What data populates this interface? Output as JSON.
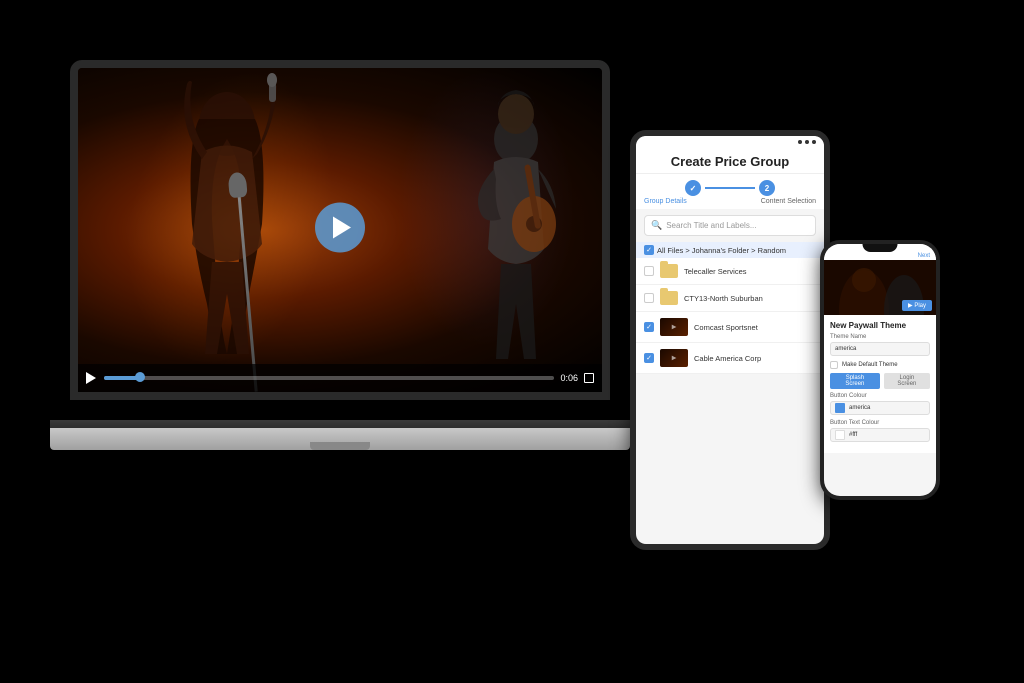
{
  "background": "#000000",
  "laptop": {
    "video": {
      "play_button_visible": true,
      "time_display": "0:06",
      "progress_percent": 8
    }
  },
  "tablet": {
    "status_dots": 3,
    "title": "Create Price Group",
    "steps": [
      {
        "label": "Group Details",
        "active": true,
        "number": "1"
      },
      {
        "label": "Content Selection",
        "active": false,
        "number": "2"
      }
    ],
    "search_placeholder": "Search Title and Labels...",
    "breadcrumb": "All Files > Johanna's Folder > Random",
    "files": [
      {
        "name": "Telecaller Services",
        "type": "folder",
        "checked": false
      },
      {
        "name": "CTY13-North Suburban",
        "type": "folder",
        "checked": false
      },
      {
        "name": "Comcast Sportsnet",
        "type": "video",
        "checked": true
      },
      {
        "name": "Cable America Corp",
        "type": "video",
        "checked": true
      }
    ]
  },
  "phone": {
    "header_time": "",
    "header_btn": "Next",
    "section_title": "New Paywall Theme",
    "form_label_theme": "Theme Name",
    "form_theme_placeholder": "america",
    "make_default_label": "Make Default Theme",
    "splash_btn": "Splash Screen",
    "login_btn": "Login Screen",
    "button_colour_label": "Button Colour",
    "button_colour_value": "america",
    "button_colour_hex": "#4a90e2",
    "button_text_label": "Button Text Colour",
    "button_text_value": "#fff"
  },
  "icons": {
    "search": "🔍",
    "play": "▶",
    "check": "✓",
    "folder": "📁"
  }
}
